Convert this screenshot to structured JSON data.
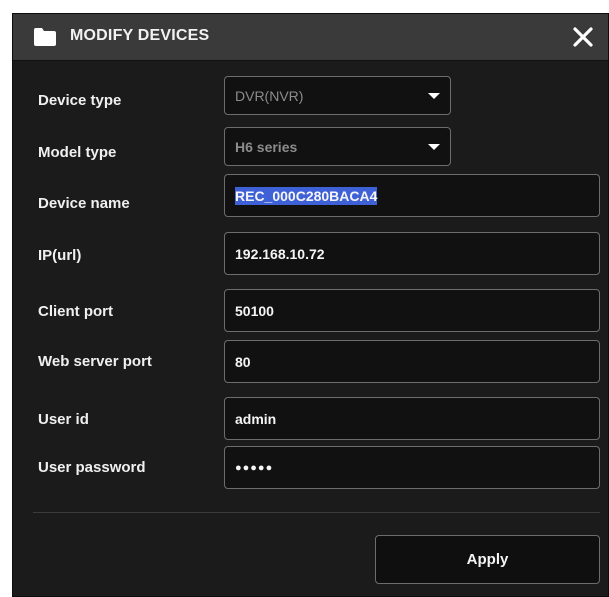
{
  "dialog": {
    "title": "MODIFY DEVICES",
    "close_icon": "close-icon",
    "title_icon": "folder-icon"
  },
  "fields": {
    "device_type": {
      "label": "Device type",
      "value": "DVR(NVR)"
    },
    "model_type": {
      "label": "Model type",
      "value": "H6 series"
    },
    "device_name": {
      "label": "Device name",
      "value": "REC_000C280BACA4"
    },
    "ip_url": {
      "label": "IP(url)",
      "value": "192.168.10.72"
    },
    "client_port": {
      "label": "Client port",
      "value": "50100"
    },
    "web_server_port": {
      "label": "Web server port",
      "value": "80"
    },
    "user_id": {
      "label": "User id",
      "value": "admin"
    },
    "user_password": {
      "label": "User password",
      "value": "●●●●●"
    }
  },
  "footer": {
    "apply_label": "Apply"
  },
  "colors": {
    "background": "#1b1b1b",
    "titlebar": "#3a3a3a",
    "field_border": "#6d6d6d",
    "selection": "#3f61d8"
  }
}
